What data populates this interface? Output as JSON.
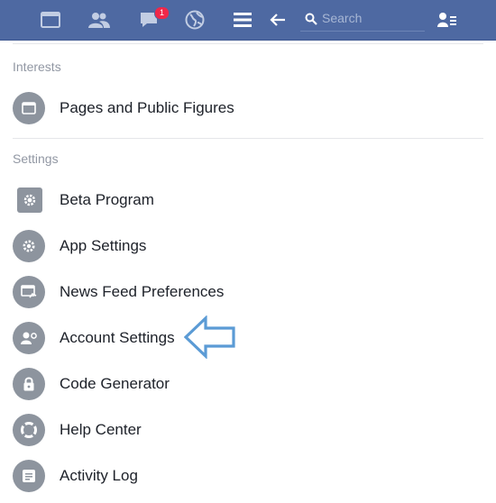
{
  "topbar": {
    "notification_count": "1",
    "search_placeholder": "Search"
  },
  "sections": {
    "interests_label": "Interests",
    "settings_label": "Settings"
  },
  "items": {
    "pages": "Pages and Public Figures",
    "beta": "Beta Program",
    "app_settings": "App Settings",
    "news_feed": "News Feed Preferences",
    "account_settings": "Account Settings",
    "code_generator": "Code Generator",
    "help_center": "Help Center",
    "activity_log": "Activity Log"
  },
  "colors": {
    "topbar": "#4e69a2",
    "icon_circle": "#8d949e",
    "arrow": "#5b9bd5"
  }
}
